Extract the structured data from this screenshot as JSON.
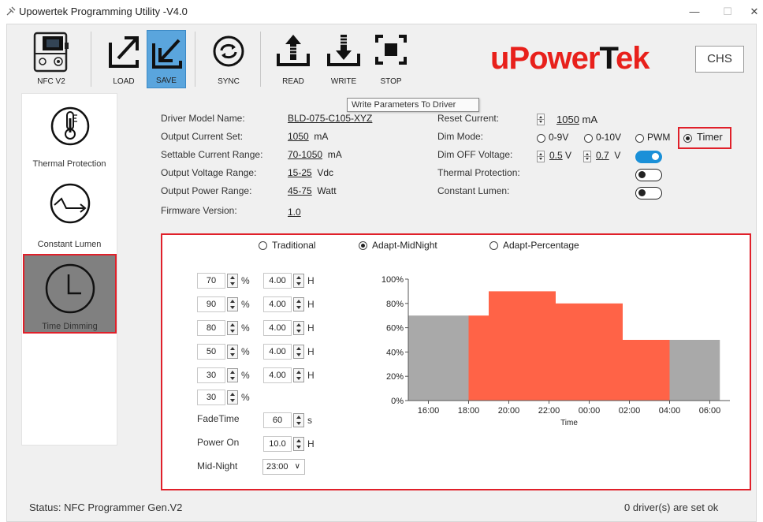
{
  "window": {
    "title": "Upowertek Programming Utility -V4.0",
    "minimize": "—",
    "maximize": "☐",
    "close": "✕"
  },
  "toolbar": {
    "nfc": "NFC V2",
    "load": "LOAD",
    "save": "SAVE",
    "sync": "SYNC",
    "read": "READ",
    "write": "WRITE",
    "stop": "STOP"
  },
  "logo": {
    "part1": "u",
    "part2": "Power",
    "part3": "T",
    "part4": "ek"
  },
  "language_button": "CHS",
  "tooltip": "Write Parameters To Driver",
  "nav": [
    {
      "label": "Thermal Protection"
    },
    {
      "label": "Constant Lumen"
    },
    {
      "label": "Time Dimming"
    }
  ],
  "info": {
    "driver_model_label": "Driver Model Name:",
    "driver_model_value": "BLD-075-C105-XYZ",
    "output_current_label": "Output Current Set:",
    "output_current_value": "1050",
    "output_current_unit": "mA",
    "settable_range_label": "Settable Current Range:",
    "settable_range_value": "70-1050",
    "settable_range_unit": "mA",
    "voltage_range_label": "Output Voltage Range:",
    "voltage_range_value": "15-25",
    "voltage_range_unit": "Vdc",
    "power_range_label": "Output Power Range:",
    "power_range_value": "45-75",
    "power_range_unit": "Watt",
    "firmware_label": "Firmware Version:",
    "firmware_value": "1.0"
  },
  "settings": {
    "reset_current_label": "Reset Current:",
    "reset_current_value": "1050",
    "reset_current_unit": "mA",
    "dim_mode_label": "Dim Mode:",
    "dim_modes": [
      "0-9V",
      "0-10V",
      "PWM",
      "Timer"
    ],
    "dim_mode_selected": "Timer",
    "dim_off_label": "Dim OFF Voltage:",
    "dim_off_v1": "0.5",
    "dim_off_v2": "0.7",
    "dim_off_unit": "V",
    "dim_off_enabled": true,
    "thermal_label": "Thermal Protection:",
    "thermal_enabled": false,
    "constant_lumen_label": "Constant Lumen:",
    "constant_lumen_enabled": false
  },
  "timer": {
    "modes": [
      "Traditional",
      "Adapt-MidNight",
      "Adapt-Percentage"
    ],
    "mode_selected": "Adapt-MidNight",
    "steps": [
      {
        "pct": "70",
        "hours": "4.00"
      },
      {
        "pct": "90",
        "hours": "4.00"
      },
      {
        "pct": "80",
        "hours": "4.00"
      },
      {
        "pct": "50",
        "hours": "4.00"
      },
      {
        "pct": "30",
        "hours": "4.00"
      },
      {
        "pct": "30",
        "hours": ""
      }
    ],
    "pct_unit": "%",
    "hour_unit": "H",
    "fade_label": "FadeTime",
    "fade_value": "60",
    "fade_unit": "s",
    "power_on_label": "Power On",
    "power_on_value": "10.0",
    "power_on_unit": "H",
    "midnight_label": "Mid-Night",
    "midnight_value": "23:00"
  },
  "chart_data": {
    "type": "bar",
    "xlabel": "Time",
    "x_ticks": [
      "16:00",
      "18:00",
      "20:00",
      "22:00",
      "00:00",
      "02:00",
      "04:00",
      "06:00"
    ],
    "y_ticks": [
      "0%",
      "20%",
      "40%",
      "60%",
      "80%",
      "100%"
    ],
    "ylim": [
      0,
      100
    ],
    "segments": [
      {
        "start": "15:00",
        "end": "18:00",
        "value": 70,
        "color": "#a9a9a9"
      },
      {
        "start": "18:00",
        "end": "19:00",
        "value": 70,
        "color": "#ff6347"
      },
      {
        "start": "19:00",
        "end": "22:20",
        "value": 90,
        "color": "#ff6347"
      },
      {
        "start": "22:20",
        "end": "01:40",
        "value": 80,
        "color": "#ff6347"
      },
      {
        "start": "01:40",
        "end": "04:00",
        "value": 50,
        "color": "#ff6347"
      },
      {
        "start": "04:00",
        "end": "06:30",
        "value": 50,
        "color": "#a9a9a9"
      }
    ]
  },
  "status": {
    "left": "Status: NFC Programmer Gen.V2",
    "right": "0 driver(s) are set ok"
  }
}
